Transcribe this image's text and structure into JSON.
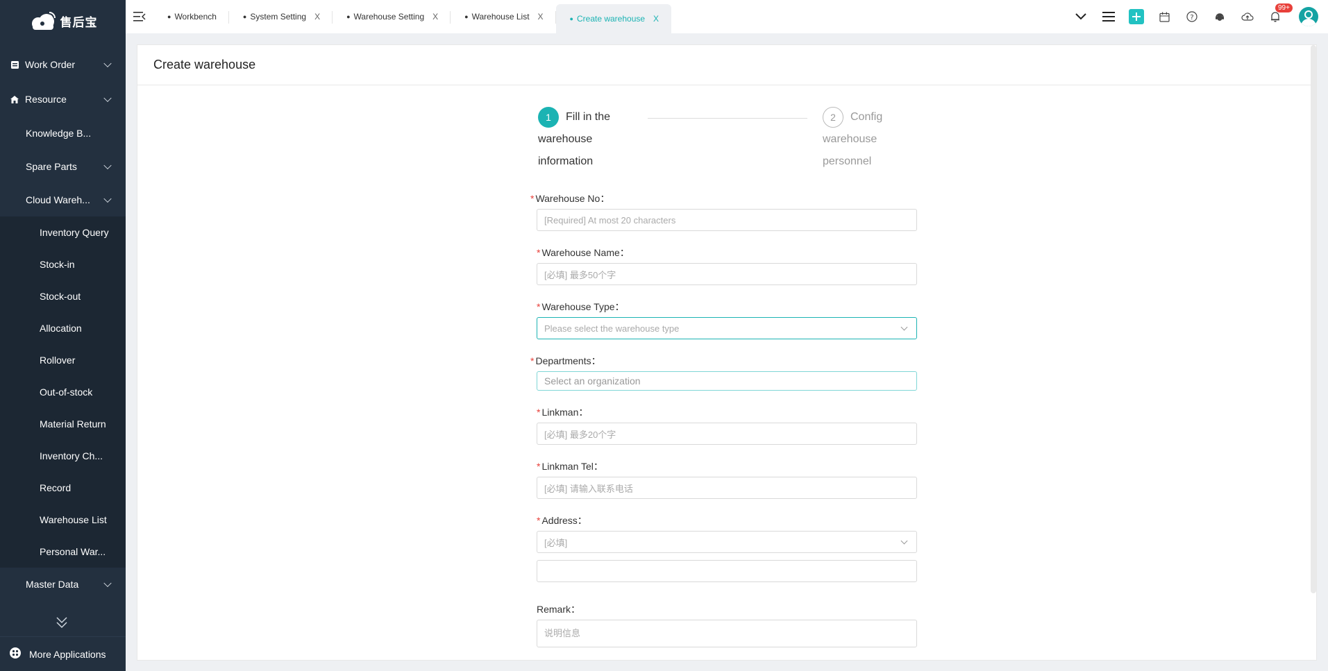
{
  "app": {
    "logo_text": "售后宝"
  },
  "sidebar": {
    "items": [
      {
        "label": "Work Order",
        "level": "top",
        "icon": "clipboard-icon",
        "expandable": true
      },
      {
        "label": "Resource",
        "level": "top",
        "icon": "home-icon",
        "expandable": true
      },
      {
        "label": "Knowledge B...",
        "level": "l1"
      },
      {
        "label": "Spare Parts",
        "level": "l1",
        "expandable": true
      },
      {
        "label": "Cloud Wareh...",
        "level": "l1",
        "expandable": true
      }
    ],
    "sub_items": [
      "Inventory Query",
      "Stock-in",
      "Stock-out",
      "Allocation",
      "Rollover",
      "Out-of-stock",
      "Material Return",
      "Inventory Ch...",
      "Record",
      "Warehouse List",
      "Personal War..."
    ],
    "master_data": "Master Data",
    "footer": "More Applications"
  },
  "tabs": [
    {
      "label": "Workbench",
      "closable": false,
      "active": false
    },
    {
      "label": "System Setting",
      "closable": true,
      "active": false
    },
    {
      "label": "Warehouse Setting",
      "closable": true,
      "active": false
    },
    {
      "label": "Warehouse List",
      "closable": true,
      "active": false
    },
    {
      "label": "Create warehouse",
      "closable": true,
      "active": true
    }
  ],
  "tab_close_glyph": "X",
  "notifications": {
    "badge": "99+"
  },
  "page": {
    "title": "Create warehouse",
    "steps": [
      {
        "num": "1",
        "line1": "Fill in the",
        "line2": "warehouse",
        "line3": "information"
      },
      {
        "num": "2",
        "line1": "Config",
        "line2": "warehouse",
        "line3": "personnel"
      }
    ]
  },
  "form": {
    "warehouse_no": {
      "label": "Warehouse No：",
      "placeholder": "[Required] At most 20 characters"
    },
    "warehouse_name": {
      "label": "Warehouse Name：",
      "placeholder": "[必填] 最多50个字"
    },
    "warehouse_type": {
      "label": "Warehouse Type：",
      "placeholder": "Please select the warehouse type"
    },
    "departments": {
      "label": "Departments：",
      "placeholder": "Select an organization"
    },
    "linkman": {
      "label": "Linkman：",
      "placeholder": "[必填] 最多20个字"
    },
    "linkman_tel": {
      "label": "Linkman Tel：",
      "placeholder": "[必填] 请输入联系电话"
    },
    "address": {
      "label": "Address：",
      "placeholder": "[必填]",
      "detail_value": ""
    },
    "remark": {
      "label": "Remark：",
      "placeholder": "说明信息"
    },
    "required_mark": "*"
  },
  "colors": {
    "accent": "#1bb3b3",
    "sidebar_bg": "#23303f",
    "required": "#e8403a"
  }
}
